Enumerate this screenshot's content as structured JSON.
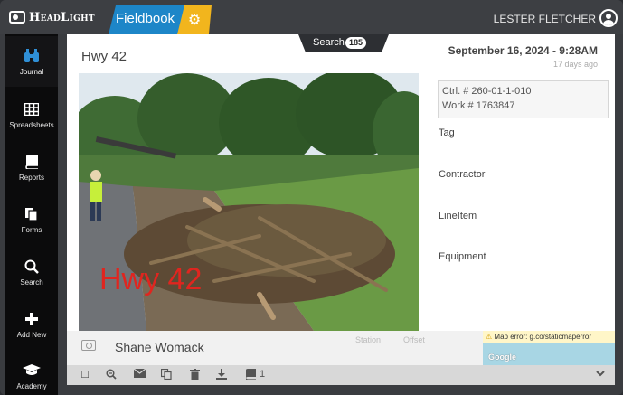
{
  "brand": {
    "name": "HeadLight",
    "app": "Fieldbook"
  },
  "user": {
    "name": "LESTER FLETCHER"
  },
  "nav": [
    {
      "label": "Journal",
      "icon": "binoculars-icon",
      "active": true
    },
    {
      "label": "Spreadsheets",
      "icon": "grid-icon"
    },
    {
      "label": "Reports",
      "icon": "book-icon"
    },
    {
      "label": "Forms",
      "icon": "forms-icon"
    },
    {
      "label": "Search",
      "icon": "search-icon"
    },
    {
      "label": "Add New",
      "icon": "plus-icon"
    },
    {
      "label": "Academy",
      "icon": "graduation-cap-icon"
    }
  ],
  "search": {
    "label": "Search",
    "count": "185"
  },
  "entry": {
    "title": "Hwy 42",
    "date": "September 16, 2024 - 9:28AM",
    "ago": "17 days ago",
    "photo_caption": "Hwy 42",
    "ctrl": "Ctrl. # 260-01-1-010",
    "work": "Work # 1763847",
    "fields": {
      "tag": "Tag",
      "contractor": "Contractor",
      "lineitem": "LineItem",
      "equipment": "Equipment"
    },
    "author": "Shane Womack",
    "station_label": "Station",
    "offset_label": "Offset"
  },
  "map": {
    "error": "Map error: g.co/staticmaperror",
    "attribution": "Google"
  },
  "toolbar": {
    "attachments_count": "1"
  },
  "colors": {
    "accent_blue": "#1d86c8",
    "accent_yellow": "#f2b51d",
    "caption_red": "#e0251f"
  }
}
